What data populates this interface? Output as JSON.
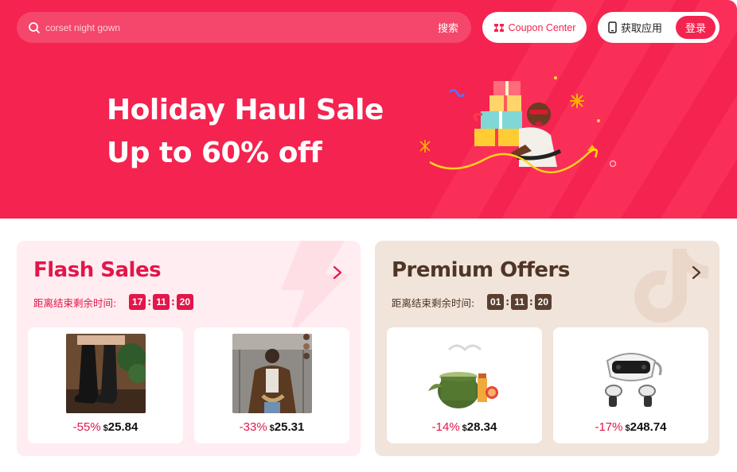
{
  "header": {
    "search_placeholder": "corset night gown",
    "search_button": "搜索",
    "coupon_label": "Coupon Center",
    "get_app_label": "获取应用",
    "login_label": "登录"
  },
  "banner": {
    "line1": "Holiday Haul Sale",
    "line2": "Up to 60% off"
  },
  "flash": {
    "title": "Flash Sales",
    "timer_label": "距离结束剩余时间:",
    "timer": [
      "17",
      "11",
      "20"
    ],
    "products": [
      {
        "discount": "-55%",
        "currency": "$",
        "price": "25.84",
        "image": "knee-high black boots"
      },
      {
        "discount": "-33%",
        "currency": "$",
        "price": "25.31",
        "image": "brown leather jacket selfie"
      }
    ]
  },
  "premium": {
    "title": "Premium Offers",
    "timer_label": "距离结束剩余时间:",
    "timer": [
      "01",
      "11",
      "20"
    ],
    "products": [
      {
        "discount": "-14%",
        "currency": "$",
        "price": "28.34",
        "image": "green glass candle"
      },
      {
        "discount": "-17%",
        "currency": "$",
        "price": "248.74",
        "image": "VR headset with controllers"
      }
    ]
  },
  "colors": {
    "brand": "#f4234f",
    "flash_accent": "#e2164a",
    "premium_accent": "#4f3526",
    "flash_bg": "#ffedf1",
    "premium_bg": "#f1e4da"
  }
}
